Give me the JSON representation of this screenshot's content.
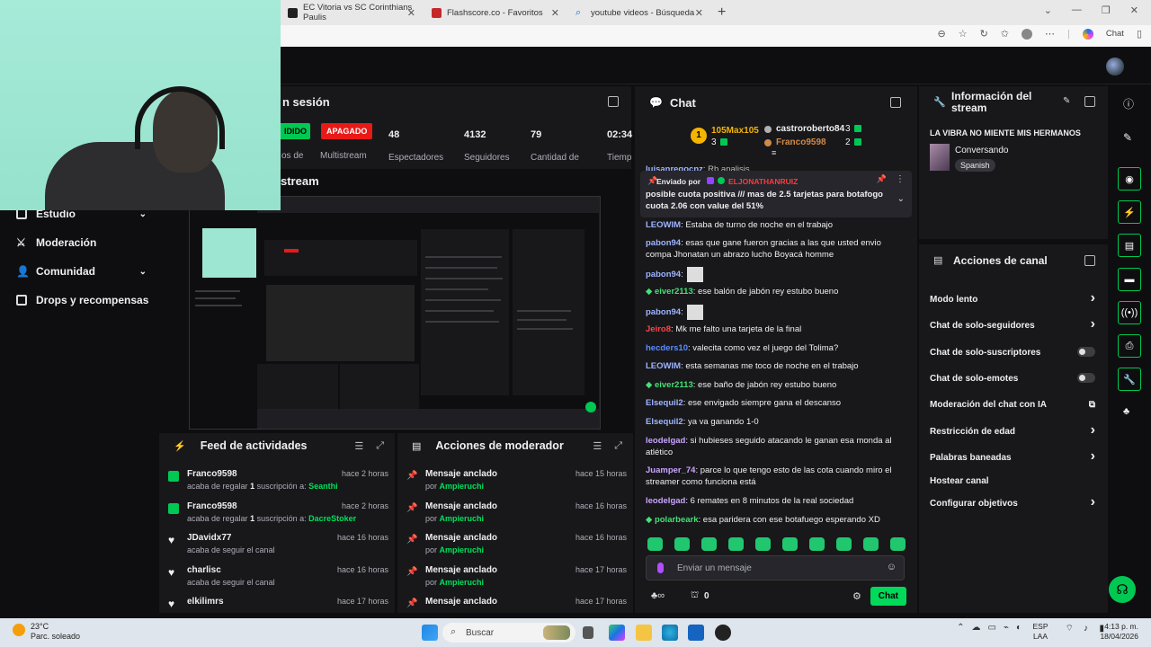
{
  "browser": {
    "tabs": [
      {
        "title": "EC Vitoria vs SC Corinthians Paulis",
        "color": "#222"
      },
      {
        "title": "Flashscore.co - Favoritos",
        "color": "#b00"
      },
      {
        "title": "youtube videos - Búsqueda",
        "color": "#1a73e8"
      }
    ],
    "chat_label": "Chat"
  },
  "sidebar": {
    "items": [
      {
        "label": "Estudio",
        "icon": "studio-icon",
        "chevron": true
      },
      {
        "label": "Moderación",
        "icon": "sword-icon",
        "chevron": false
      },
      {
        "label": "Comunidad",
        "icon": "community-icon",
        "chevron": true
      },
      {
        "label": "Drops y recompensas",
        "icon": "drops-icon",
        "chevron": false
      }
    ]
  },
  "session": {
    "title": "n sesión",
    "live_badge": "IDIDO",
    "offline_badge": "APAGADO",
    "stats": [
      {
        "value": "48",
        "label": "Espectadores"
      },
      {
        "value": "4132",
        "label": "Seguidores"
      },
      {
        "value": "79",
        "label": "Cantidad de"
      },
      {
        "value": "02:34",
        "label": "Tiemp"
      }
    ],
    "partial_label": "os de",
    "multistream": "Multistream",
    "preview_title": "stream"
  },
  "feed": {
    "title": "Feed de actividades",
    "items": [
      {
        "name": "Franco9598",
        "time": "hace 2 horas",
        "pre": "acaba de regalar ",
        "count": "1",
        "mid": " suscripción a: ",
        "target": "Seanthi",
        "icon": "gift-icon"
      },
      {
        "name": "Franco9598",
        "time": "hace 2 horas",
        "pre": "acaba de regalar ",
        "count": "1",
        "mid": " suscripción a: ",
        "target": "DacreStoker",
        "icon": "gift-icon"
      },
      {
        "name": "JDavidx77",
        "time": "hace 16 horas",
        "pre": "acaba de seguir el canal",
        "count": "",
        "mid": "",
        "target": "",
        "icon": "heart-icon"
      },
      {
        "name": "charlisc",
        "time": "hace 16 horas",
        "pre": "acaba de seguir el canal",
        "count": "",
        "mid": "",
        "target": "",
        "icon": "heart-icon"
      },
      {
        "name": "elkilimrs",
        "time": "hace 17 horas",
        "pre": "",
        "count": "",
        "mid": "",
        "target": "",
        "icon": "heart-icon"
      }
    ]
  },
  "mod": {
    "title": "Acciones de moderador",
    "items": [
      {
        "action": "Mensaje anclado",
        "by": "por ",
        "user": "Ampieruchi",
        "time": "hace 15 horas"
      },
      {
        "action": "Mensaje anclado",
        "by": "por ",
        "user": "Ampieruchi",
        "time": "hace 16 horas"
      },
      {
        "action": "Mensaje anclado",
        "by": "por ",
        "user": "Ampieruchi",
        "time": "hace 16 horas"
      },
      {
        "action": "Mensaje anclado",
        "by": "por ",
        "user": "Ampieruchi",
        "time": "hace 17 horas"
      },
      {
        "action": "Mensaje anclado",
        "by": "",
        "user": "",
        "time": "hace 17 horas"
      }
    ]
  },
  "chat": {
    "title": "Chat",
    "leader": {
      "first_name": "105Max105",
      "first_count": "3",
      "second_name": "castroroberto84",
      "second_count": "3",
      "third_name": "Franco9598",
      "third_count": "2",
      "rank": "1"
    },
    "cut_line": {
      "user": "luisanregocnz",
      "text": ": Rb analisis"
    },
    "pinned": {
      "by_label": "Enviado por",
      "by_user": "ELJONATHANRUIZ",
      "text": "posible cuota positiva /// mas de 2.5 tarjetas para botafogo cuota 2.06 con value del 51%"
    },
    "messages": [
      {
        "user": "LEOWIM",
        "color": "#9eb4ff",
        "text": ": Estaba de turno de noche en el trabajo"
      },
      {
        "user": "pabon94",
        "color": "#9eb4ff",
        "text": ": esas que gane fueron gracias a las que usted envio compa Jhonatan un abrazo lucho Boyacá homme"
      },
      {
        "user": "pabon94",
        "color": "#9eb4ff",
        "text": ":"
      },
      {
        "user": "eiver2113",
        "color": "#46e075",
        "text": ": ese balón de jabón rey  estubo bueno"
      },
      {
        "user": "pabon94",
        "color": "#9eb4ff",
        "text": ":"
      },
      {
        "user": "Jeiro8",
        "color": "#ff4545",
        "text": ": Mk me falto una tarjeta de la final"
      },
      {
        "user": "hecders10",
        "color": "#5c8cff",
        "text": ": valecita como vez el juego del Tolima?"
      },
      {
        "user": "LEOWIM",
        "color": "#9eb4ff",
        "text": ": esta semanas me toco de noche en el trabajo"
      },
      {
        "user": "eiver2113",
        "color": "#46e075",
        "text": ": ese baño de jabón  rey estubo bueno"
      },
      {
        "user": "Elsequil2",
        "color": "#9eb4ff",
        "text": ": ese envigado siempre gana el descanso"
      },
      {
        "user": "Elsequil2",
        "color": "#9eb4ff",
        "text": ": ya va ganando 1-0"
      },
      {
        "user": "leodelgad",
        "color": "#c9a3ff",
        "text": ": si hubieses seguido atacando le ganan esa monda al atlético"
      },
      {
        "user": "Juamper_74",
        "color": "#c9a3ff",
        "text": ": parce lo que tengo esto de las cota cuando miro el streamer como funciona está"
      },
      {
        "user": "leodelgad",
        "color": "#c9a3ff",
        "text": ": 6 remates en 8 minutos de la real sociedad"
      },
      {
        "user": "polarbeark",
        "color": "#46e075",
        "text": ": esa paridera con ese botafuego esperando XD"
      }
    ],
    "input_placeholder": "Enviar un mensaje",
    "points": "0",
    "send_label": "Chat"
  },
  "info": {
    "title_line1": "Información del",
    "title_line2": "stream",
    "stream_title": "LA VIBRA NO MIENTE MIS HERMANOS",
    "category": "Conversando",
    "tag": "Spanish"
  },
  "canal": {
    "title": "Acciones de canal",
    "items": [
      {
        "label": "Modo lento",
        "control": "chevron"
      },
      {
        "label": "Chat de solo-seguidores",
        "control": "chevron"
      },
      {
        "label": "Chat de solo-suscriptores",
        "control": "toggle"
      },
      {
        "label": "Chat de solo-emotes",
        "control": "toggle"
      },
      {
        "label": "Moderación del chat con IA",
        "control": "external"
      },
      {
        "label": "Restricción de edad",
        "control": "chevron"
      },
      {
        "label": "Palabras baneadas",
        "control": "chevron"
      },
      {
        "label": "Hostear canal",
        "control": "none"
      },
      {
        "label": "Configurar objetivos",
        "control": "chevron"
      }
    ]
  },
  "taskbar": {
    "temp": "23°C",
    "weather": "Parc. soleado",
    "search": "Buscar",
    "lang1": "ESP",
    "lang2": "LAA",
    "time": "4:13 p. m.",
    "date": "18/04/2026"
  },
  "colors": {
    "accent": "#00c853",
    "live_red": "#e91916",
    "bg": "#0e0e10",
    "panel": "#18181b"
  }
}
